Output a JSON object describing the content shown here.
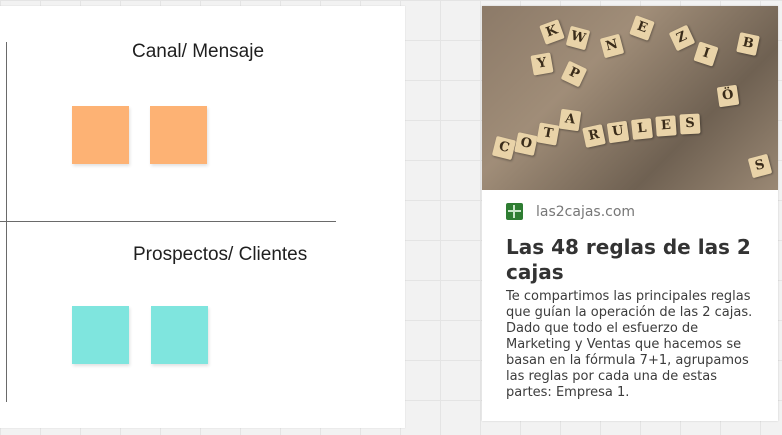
{
  "board": {
    "section_top_label": "Canal/ Mensaje",
    "section_bottom_label": "Prospectos/ Clientes",
    "sticky_orange_color": "#fdb274",
    "sticky_teal_color": "#7fe5de"
  },
  "link_card": {
    "source": "las2cajas.com",
    "favicon": "book-icon",
    "title": "Las 48 reglas de las 2 cajas",
    "description": "Te compartimos las principales reglas que guían la operación de las 2 cajas. Dado que todo el esfuerzo de Marketing y Ventas que hacemos se basan en la fórmula 7+1, agrupamos las reglas por cada una de estas partes: Empresa 1.",
    "image_tiles": [
      "R",
      "U",
      "L",
      "E",
      "S",
      "C",
      "O",
      "T",
      "A",
      "K",
      "W",
      "Y",
      "P",
      "N",
      "E",
      "Z",
      "I",
      "Ö",
      "B",
      "S"
    ]
  }
}
